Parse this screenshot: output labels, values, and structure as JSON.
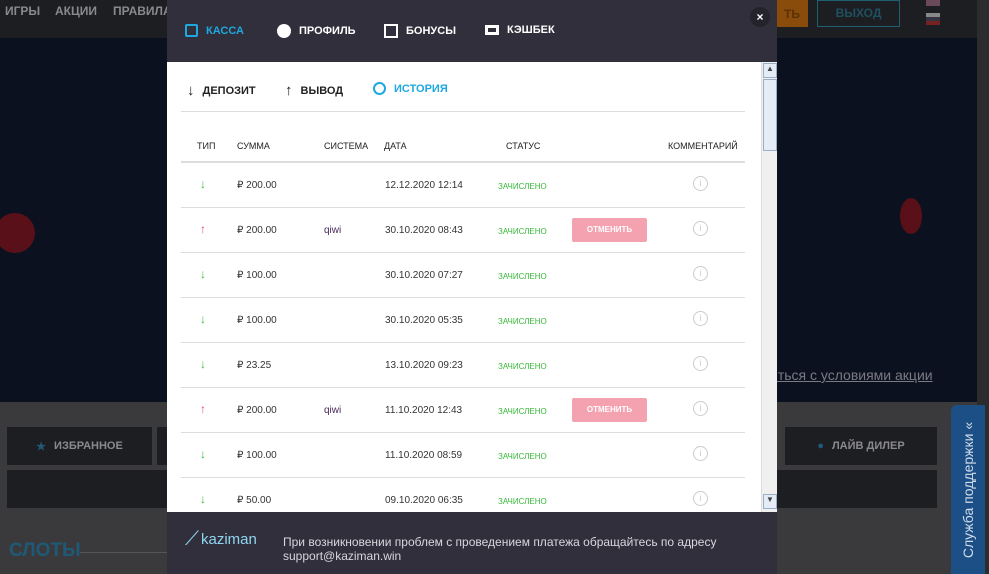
{
  "background": {
    "nav": [
      "ИГРЫ",
      "АКЦИИ",
      "ПРАВИЛА"
    ],
    "deposit_btn_partial": "ТЬ",
    "logout": "ВЫХОД",
    "promo_link": "иться с условиями акции",
    "categories": {
      "favorites": "ИЗБРАННОЕ",
      "live_dealer": "ЛАЙВ ДИЛЕР"
    },
    "section_title": "СЛОТЫ",
    "support": "Служба поддержки «"
  },
  "modal": {
    "tabs": [
      {
        "label": "КАССА",
        "icon": "wallet-icon"
      },
      {
        "label": "ПРОФИЛЬ",
        "icon": "profile-icon"
      },
      {
        "label": "БОНУСЫ",
        "icon": "gift-icon"
      },
      {
        "label": "КЭШБЕК",
        "icon": "cashback-icon"
      }
    ],
    "close": "×",
    "subtabs": [
      {
        "label": "ДЕПОЗИТ",
        "icon": "↓"
      },
      {
        "label": "ВЫВОД",
        "icon": "↑"
      },
      {
        "label": "ИСТОРИЯ",
        "icon": "🕓"
      }
    ],
    "columns": [
      "ТИП",
      "СУММА",
      "СИСТЕМА",
      "ДАТА",
      "СТАТУС",
      "КОММЕНТАРИЙ"
    ],
    "rows": [
      {
        "type": "↓",
        "amount": "₽ 200.00",
        "system": "",
        "date": "12.12.2020 12:14",
        "status": "ЗАЧИСЛЕНО",
        "action": ""
      },
      {
        "type": "↑",
        "amount": "₽ 200.00",
        "system": "qiwi",
        "date": "30.10.2020 08:43",
        "status": "ЗАЧИСЛЕНО",
        "action": "ОТМЕНИТЬ"
      },
      {
        "type": "↓",
        "amount": "₽ 100.00",
        "system": "",
        "date": "30.10.2020 07:27",
        "status": "ЗАЧИСЛЕНО",
        "action": ""
      },
      {
        "type": "↓",
        "amount": "₽ 100.00",
        "system": "",
        "date": "30.10.2020 05:35",
        "status": "ЗАЧИСЛЕНО",
        "action": ""
      },
      {
        "type": "↓",
        "amount": "₽ 23.25",
        "system": "",
        "date": "13.10.2020 09:23",
        "status": "ЗАЧИСЛЕНО",
        "action": ""
      },
      {
        "type": "↑",
        "amount": "₽ 200.00",
        "system": "qiwi",
        "date": "11.10.2020 12:43",
        "status": "ЗАЧИСЛЕНО",
        "action": "ОТМЕНИТЬ"
      },
      {
        "type": "↓",
        "amount": "₽ 100.00",
        "system": "",
        "date": "11.10.2020 08:59",
        "status": "ЗАЧИСЛЕНО",
        "action": ""
      },
      {
        "type": "↓",
        "amount": "₽ 50.00",
        "system": "",
        "date": "09.10.2020 06:35",
        "status": "ЗАЧИСЛЕНО",
        "action": ""
      }
    ],
    "footer": {
      "logo": "kaziman",
      "text": "При возникновении проблем с проведением платежа обращайтесь по адресу support@kaziman.win"
    }
  },
  "colors": {
    "accent": "#1ea8e0",
    "success": "#3ab83a",
    "cancel": "#f4a1b0",
    "in": "#3ab83a",
    "out": "#e0506a"
  }
}
